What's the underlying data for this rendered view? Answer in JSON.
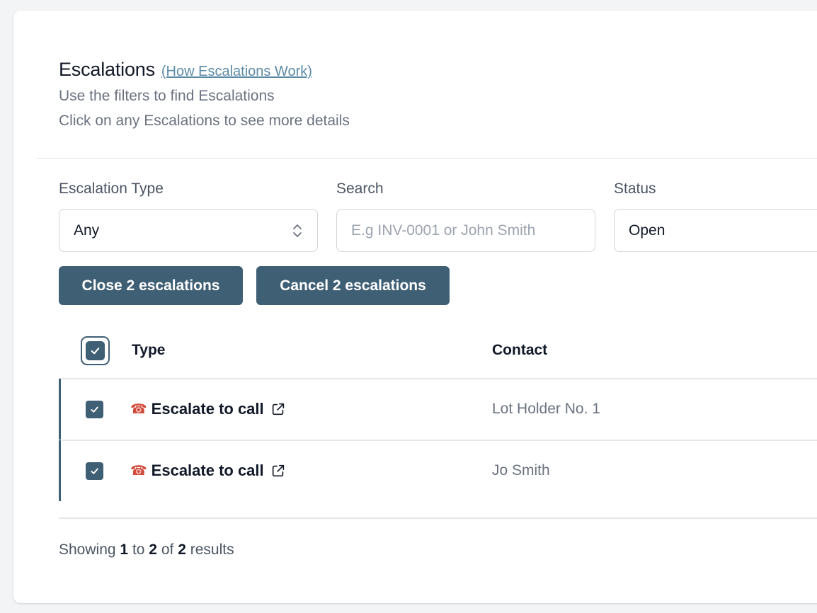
{
  "header": {
    "title": "Escalations",
    "help_link": "(How Escalations Work)",
    "subtitle_1": "Use the filters to find Escalations",
    "subtitle_2": "Click on any Escalations to see more details"
  },
  "filters": {
    "type_label": "Escalation Type",
    "type_value": "Any",
    "search_label": "Search",
    "search_placeholder": "E.g INV-0001 or John Smith",
    "status_label": "Status",
    "status_value": "Open"
  },
  "actions": {
    "close_label": "Close 2 escalations",
    "cancel_label": "Cancel 2 escalations"
  },
  "table": {
    "columns": [
      "Type",
      "Contact"
    ],
    "select_all_checked": true,
    "rows": [
      {
        "checked": true,
        "icon": "telephone-icon",
        "type": "Escalate to call",
        "contact": "Lot Holder No. 1"
      },
      {
        "checked": true,
        "icon": "telephone-icon",
        "type": "Escalate to call",
        "contact": "Jo Smith"
      }
    ]
  },
  "pagination": {
    "prefix": "Showing",
    "from": "1",
    "to_word": "to",
    "to": "2",
    "of_word": "of",
    "total": "2",
    "suffix": "results"
  },
  "colors": {
    "accent": "#3f5f75",
    "link": "#5b8aa6",
    "muted_text": "#6b7280",
    "border": "#d1d5db"
  }
}
